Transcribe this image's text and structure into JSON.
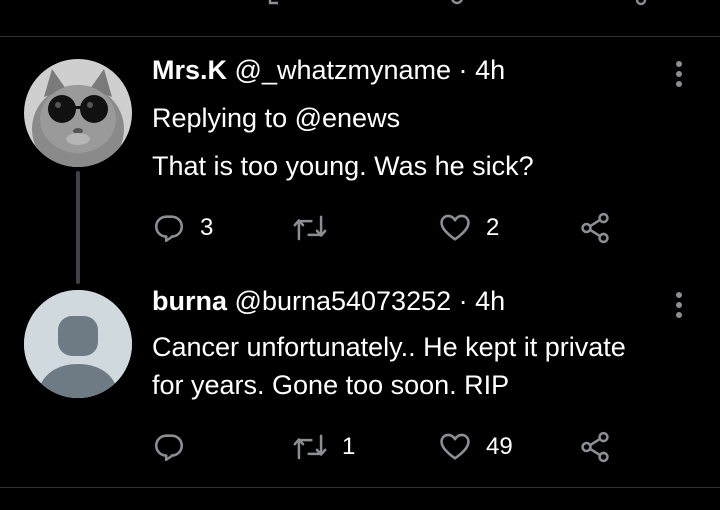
{
  "tweets": [
    {
      "name": "Mrs.K",
      "handle": "@_whatzmyname",
      "separator": "·",
      "time": "4h",
      "replying_prefix": "Replying to",
      "replying_to": "@enews",
      "text_lines": [
        "That is too young. Was he sick?"
      ],
      "avatar": "cat-with-sunglasses",
      "actions": {
        "replies": "3",
        "retweets": "",
        "likes": "2"
      }
    },
    {
      "name": "burna",
      "handle": "@burna54073252",
      "separator": "·",
      "time": "4h",
      "text_lines": [
        "Cancer unfortunately.. He kept it private",
        "for years. Gone too soon. RIP"
      ],
      "avatar": "default-person",
      "actions": {
        "replies": "",
        "retweets": "1",
        "likes": "49"
      }
    }
  ],
  "colors": {
    "background": "#000000",
    "text": "#ffffff",
    "icon": "#8b8f94",
    "divider": "#2f3336",
    "default_avatar_bg": "#cfd9de",
    "default_avatar_fg": "#6e7b85"
  },
  "icons": [
    "reply-icon",
    "retweet-icon",
    "like-icon",
    "share-icon",
    "more-icon"
  ]
}
